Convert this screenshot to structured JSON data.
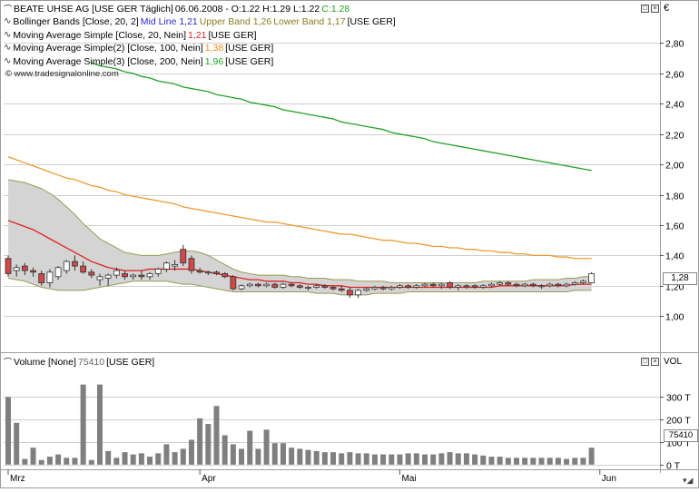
{
  "main_panel": {
    "header_symbol": "BEATE UHSE AG [USE GER  Täglich]",
    "header_ohlc": "06.06.2008 - O:1.22 H:1.29 L:1.22",
    "header_close": "C:1.28",
    "currency": "€",
    "price_tag": "1,28",
    "watermark": "© www.tradesignalonline.com",
    "indicators": [
      {
        "prefix": "Bollinger Bands [Close, 20, 2]",
        "parts": [
          {
            "text": "Mid Line 1,21",
            "color": "#2a2acc"
          },
          {
            "text": "Upper Band 1,26",
            "color": "#8a7a20"
          },
          {
            "text": "Lower Band 1,17",
            "color": "#8a7a20"
          },
          {
            "text": "[USE GER]",
            "color": "#000000"
          }
        ]
      },
      {
        "prefix": "Moving Average Simple [Close, 20, Nein]",
        "parts": [
          {
            "text": "1,21",
            "color": "#e02020"
          },
          {
            "text": "[USE GER]",
            "color": "#000000"
          }
        ]
      },
      {
        "prefix": "Moving Average Simple(2) [Close, 100, Nein]",
        "parts": [
          {
            "text": "1,38",
            "color": "#ee8a10"
          },
          {
            "text": "[USE GER]",
            "color": "#000000"
          }
        ]
      },
      {
        "prefix": "Moving Average Simple(3) [Close, 200, Nein]",
        "parts": [
          {
            "text": "1,96",
            "color": "#22a022"
          },
          {
            "text": "[USE GER]",
            "color": "#000000"
          }
        ]
      }
    ]
  },
  "volume_panel": {
    "header": "Volume [None]",
    "header_value": "75410",
    "header_suffix": "[USE GER]",
    "axis_title": "VOL",
    "value_tag": "75410"
  },
  "colors": {
    "up_candle": "#ffffff",
    "down_candle": "#d04848",
    "candle_outline": "#333333",
    "bb_fill": "#d4d4d4",
    "bb_line": "#9a9a50",
    "sma20": "#e02020",
    "sma100": "#ee9a30",
    "sma200": "#22a022",
    "volume_bar": "#7f7f7f",
    "grid": "#cfcfcf",
    "close_up": "#22a022"
  },
  "chart_data": [
    {
      "type": "candlestick",
      "ylim": [
        0.78,
        3.0
      ],
      "yticks": [
        "1,00",
        "1,20",
        "1,40",
        "1,60",
        "1,80",
        "2,00",
        "2,20",
        "2,40",
        "2,60",
        "2,80"
      ],
      "ytick_values": [
        1.0,
        1.2,
        1.4,
        1.6,
        1.8,
        2.0,
        2.2,
        2.4,
        2.6,
        2.8
      ],
      "x_labels": [
        "Mrz",
        "Apr",
        "Mai",
        "Jun"
      ],
      "x_label_index": [
        0,
        23,
        47,
        71
      ],
      "ohlc": [
        [
          1.38,
          1.4,
          1.26,
          1.28
        ],
        [
          1.3,
          1.34,
          1.26,
          1.32
        ],
        [
          1.33,
          1.35,
          1.27,
          1.3
        ],
        [
          1.3,
          1.32,
          1.26,
          1.29
        ],
        [
          1.28,
          1.3,
          1.2,
          1.22
        ],
        [
          1.22,
          1.31,
          1.19,
          1.29
        ],
        [
          1.26,
          1.33,
          1.24,
          1.32
        ],
        [
          1.3,
          1.37,
          1.28,
          1.36
        ],
        [
          1.36,
          1.4,
          1.3,
          1.33
        ],
        [
          1.33,
          1.36,
          1.28,
          1.29
        ],
        [
          1.29,
          1.31,
          1.25,
          1.27
        ],
        [
          1.24,
          1.28,
          1.2,
          1.26
        ],
        [
          1.25,
          1.28,
          1.2,
          1.27
        ],
        [
          1.27,
          1.32,
          1.25,
          1.3
        ],
        [
          1.28,
          1.3,
          1.24,
          1.26
        ],
        [
          1.26,
          1.28,
          1.24,
          1.27
        ],
        [
          1.27,
          1.3,
          1.24,
          1.26
        ],
        [
          1.26,
          1.29,
          1.24,
          1.28
        ],
        [
          1.28,
          1.32,
          1.26,
          1.31
        ],
        [
          1.31,
          1.36,
          1.29,
          1.35
        ],
        [
          1.33,
          1.37,
          1.3,
          1.34
        ],
        [
          1.44,
          1.47,
          1.33,
          1.35
        ],
        [
          1.38,
          1.4,
          1.28,
          1.3
        ],
        [
          1.3,
          1.32,
          1.28,
          1.29
        ],
        [
          1.29,
          1.3,
          1.27,
          1.29
        ],
        [
          1.29,
          1.3,
          1.27,
          1.28
        ],
        [
          1.28,
          1.29,
          1.25,
          1.26
        ],
        [
          1.26,
          1.27,
          1.17,
          1.18
        ],
        [
          1.18,
          1.21,
          1.17,
          1.2
        ],
        [
          1.2,
          1.22,
          1.19,
          1.21
        ],
        [
          1.21,
          1.22,
          1.19,
          1.2
        ],
        [
          1.2,
          1.22,
          1.19,
          1.21
        ],
        [
          1.21,
          1.22,
          1.18,
          1.19
        ],
        [
          1.19,
          1.22,
          1.18,
          1.21
        ],
        [
          1.21,
          1.22,
          1.19,
          1.2
        ],
        [
          1.2,
          1.21,
          1.18,
          1.19
        ],
        [
          1.19,
          1.2,
          1.17,
          1.19
        ],
        [
          1.19,
          1.21,
          1.18,
          1.2
        ],
        [
          1.2,
          1.21,
          1.18,
          1.19
        ],
        [
          1.19,
          1.2,
          1.17,
          1.18
        ],
        [
          1.18,
          1.2,
          1.16,
          1.17
        ],
        [
          1.17,
          1.19,
          1.12,
          1.14
        ],
        [
          1.14,
          1.18,
          1.12,
          1.17
        ],
        [
          1.17,
          1.19,
          1.16,
          1.18
        ],
        [
          1.18,
          1.2,
          1.17,
          1.19
        ],
        [
          1.19,
          1.2,
          1.17,
          1.18
        ],
        [
          1.18,
          1.2,
          1.17,
          1.19
        ],
        [
          1.19,
          1.21,
          1.18,
          1.2
        ],
        [
          1.2,
          1.21,
          1.18,
          1.19
        ],
        [
          1.19,
          1.21,
          1.18,
          1.2
        ],
        [
          1.2,
          1.22,
          1.19,
          1.21
        ],
        [
          1.21,
          1.22,
          1.19,
          1.2
        ],
        [
          1.2,
          1.22,
          1.18,
          1.21
        ],
        [
          1.22,
          1.23,
          1.18,
          1.19
        ],
        [
          1.19,
          1.21,
          1.17,
          1.2
        ],
        [
          1.2,
          1.21,
          1.18,
          1.2
        ],
        [
          1.2,
          1.21,
          1.18,
          1.19
        ],
        [
          1.19,
          1.21,
          1.18,
          1.2
        ],
        [
          1.2,
          1.22,
          1.19,
          1.21
        ],
        [
          1.21,
          1.23,
          1.2,
          1.22
        ],
        [
          1.22,
          1.23,
          1.2,
          1.21
        ],
        [
          1.21,
          1.22,
          1.19,
          1.2
        ],
        [
          1.2,
          1.22,
          1.19,
          1.21
        ],
        [
          1.21,
          1.22,
          1.19,
          1.2
        ],
        [
          1.2,
          1.21,
          1.18,
          1.2
        ],
        [
          1.2,
          1.22,
          1.19,
          1.21
        ],
        [
          1.21,
          1.22,
          1.19,
          1.2
        ],
        [
          1.2,
          1.22,
          1.19,
          1.21
        ],
        [
          1.21,
          1.23,
          1.2,
          1.22
        ],
        [
          1.22,
          1.24,
          1.21,
          1.23
        ],
        [
          1.22,
          1.29,
          1.22,
          1.28
        ]
      ],
      "bollinger": {
        "upper": [
          1.9,
          1.89,
          1.88,
          1.86,
          1.84,
          1.81,
          1.77,
          1.72,
          1.67,
          1.61,
          1.56,
          1.51,
          1.48,
          1.45,
          1.42,
          1.41,
          1.4,
          1.4,
          1.4,
          1.41,
          1.42,
          1.43,
          1.43,
          1.42,
          1.4,
          1.37,
          1.34,
          1.31,
          1.29,
          1.28,
          1.27,
          1.27,
          1.27,
          1.27,
          1.26,
          1.26,
          1.25,
          1.25,
          1.25,
          1.24,
          1.24,
          1.24,
          1.23,
          1.23,
          1.23,
          1.23,
          1.22,
          1.22,
          1.22,
          1.22,
          1.22,
          1.22,
          1.22,
          1.22,
          1.22,
          1.22,
          1.22,
          1.23,
          1.23,
          1.23,
          1.23,
          1.23,
          1.23,
          1.24,
          1.24,
          1.24,
          1.24,
          1.25,
          1.25,
          1.26,
          1.26
        ],
        "lower": [
          1.25,
          1.24,
          1.23,
          1.21,
          1.19,
          1.18,
          1.17,
          1.17,
          1.17,
          1.17,
          1.18,
          1.19,
          1.2,
          1.21,
          1.22,
          1.23,
          1.23,
          1.23,
          1.23,
          1.23,
          1.22,
          1.21,
          1.21,
          1.2,
          1.19,
          1.18,
          1.17,
          1.16,
          1.16,
          1.16,
          1.16,
          1.16,
          1.16,
          1.16,
          1.16,
          1.16,
          1.16,
          1.15,
          1.15,
          1.15,
          1.14,
          1.14,
          1.14,
          1.14,
          1.15,
          1.15,
          1.15,
          1.15,
          1.16,
          1.16,
          1.16,
          1.16,
          1.16,
          1.16,
          1.16,
          1.16,
          1.16,
          1.16,
          1.16,
          1.16,
          1.16,
          1.16,
          1.16,
          1.16,
          1.16,
          1.16,
          1.16,
          1.16,
          1.17,
          1.17,
          1.17
        ]
      },
      "sma20": [
        1.63,
        1.61,
        1.59,
        1.57,
        1.54,
        1.51,
        1.48,
        1.45,
        1.42,
        1.39,
        1.36,
        1.34,
        1.32,
        1.31,
        1.3,
        1.3,
        1.3,
        1.31,
        1.31,
        1.31,
        1.31,
        1.31,
        1.31,
        1.3,
        1.29,
        1.28,
        1.27,
        1.26,
        1.25,
        1.24,
        1.24,
        1.23,
        1.23,
        1.23,
        1.22,
        1.22,
        1.21,
        1.21,
        1.2,
        1.2,
        1.2,
        1.19,
        1.19,
        1.19,
        1.19,
        1.19,
        1.19,
        1.19,
        1.19,
        1.19,
        1.19,
        1.19,
        1.19,
        1.19,
        1.19,
        1.19,
        1.19,
        1.19,
        1.19,
        1.2,
        1.2,
        1.2,
        1.2,
        1.2,
        1.2,
        1.2,
        1.2,
        1.2,
        1.21,
        1.21,
        1.21
      ],
      "sma100": [
        2.05,
        2.03,
        2.01,
        1.99,
        1.97,
        1.95,
        1.93,
        1.91,
        1.9,
        1.88,
        1.86,
        1.85,
        1.83,
        1.82,
        1.8,
        1.79,
        1.78,
        1.77,
        1.76,
        1.75,
        1.74,
        1.72,
        1.71,
        1.7,
        1.69,
        1.68,
        1.67,
        1.66,
        1.65,
        1.64,
        1.63,
        1.62,
        1.62,
        1.61,
        1.6,
        1.59,
        1.58,
        1.57,
        1.56,
        1.55,
        1.54,
        1.54,
        1.53,
        1.52,
        1.51,
        1.5,
        1.5,
        1.49,
        1.48,
        1.48,
        1.47,
        1.46,
        1.46,
        1.45,
        1.45,
        1.44,
        1.44,
        1.43,
        1.43,
        1.42,
        1.42,
        1.41,
        1.41,
        1.4,
        1.4,
        1.4,
        1.39,
        1.39,
        1.38,
        1.38,
        1.38
      ],
      "sma200": [
        null,
        null,
        null,
        null,
        null,
        null,
        null,
        null,
        null,
        null,
        2.67,
        2.65,
        2.64,
        2.63,
        2.61,
        2.6,
        2.58,
        2.57,
        2.55,
        2.54,
        2.53,
        2.51,
        2.5,
        2.49,
        2.48,
        2.46,
        2.45,
        2.44,
        2.43,
        2.41,
        2.4,
        2.39,
        2.38,
        2.36,
        2.35,
        2.34,
        2.33,
        2.32,
        2.31,
        2.3,
        2.28,
        2.27,
        2.26,
        2.25,
        2.24,
        2.23,
        2.21,
        2.2,
        2.19,
        2.18,
        2.17,
        2.15,
        2.14,
        2.13,
        2.12,
        2.11,
        2.1,
        2.09,
        2.08,
        2.07,
        2.06,
        2.05,
        2.04,
        2.03,
        2.02,
        2.01,
        2.0,
        1.99,
        1.98,
        1.97,
        1.96
      ]
    },
    {
      "type": "bar",
      "series_name": "Volume",
      "ylim": [
        -25,
        430
      ],
      "yticks": [
        "0 T",
        "100 T",
        "200 T",
        "300 T"
      ],
      "ytick_values": [
        0,
        100,
        200,
        300
      ],
      "values": [
        300,
        185,
        25,
        75,
        20,
        35,
        45,
        30,
        30,
        355,
        20,
        355,
        60,
        30,
        55,
        45,
        50,
        35,
        50,
        90,
        55,
        70,
        110,
        205,
        180,
        260,
        130,
        90,
        70,
        150,
        70,
        155,
        95,
        95,
        75,
        70,
        65,
        60,
        55,
        55,
        50,
        55,
        50,
        50,
        45,
        45,
        45,
        45,
        50,
        50,
        45,
        45,
        50,
        55,
        50,
        50,
        45,
        40,
        35,
        35,
        30,
        30,
        30,
        30,
        30,
        30,
        30,
        25,
        30,
        30,
        75
      ]
    }
  ]
}
